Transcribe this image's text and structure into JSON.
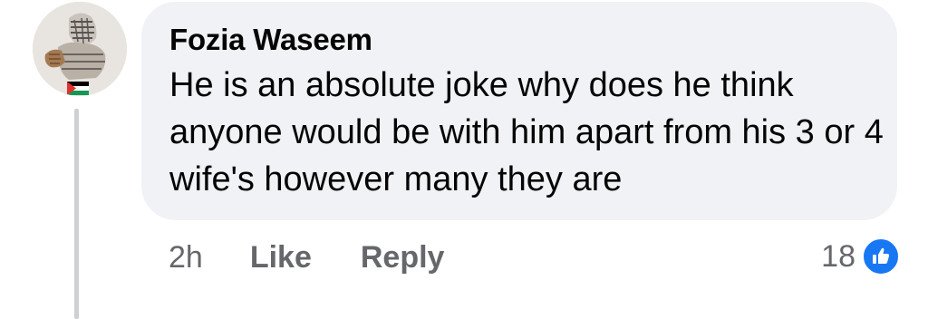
{
  "comment": {
    "author": "Fozia Waseem",
    "text": "He is an absolute joke why does he think anyone would be with him apart from his 3 or 4 wife's however many they are",
    "time": "2h",
    "like_label": "Like",
    "reply_label": "Reply",
    "reaction_count": "18",
    "reaction_icon": "like-thumbs-up-icon"
  },
  "colors": {
    "bubble_bg": "#f0f2f5",
    "secondary_text": "#65676b",
    "primary_text": "#050505",
    "like_blue": "#1877f2",
    "thread_line": "#ced0d4"
  }
}
